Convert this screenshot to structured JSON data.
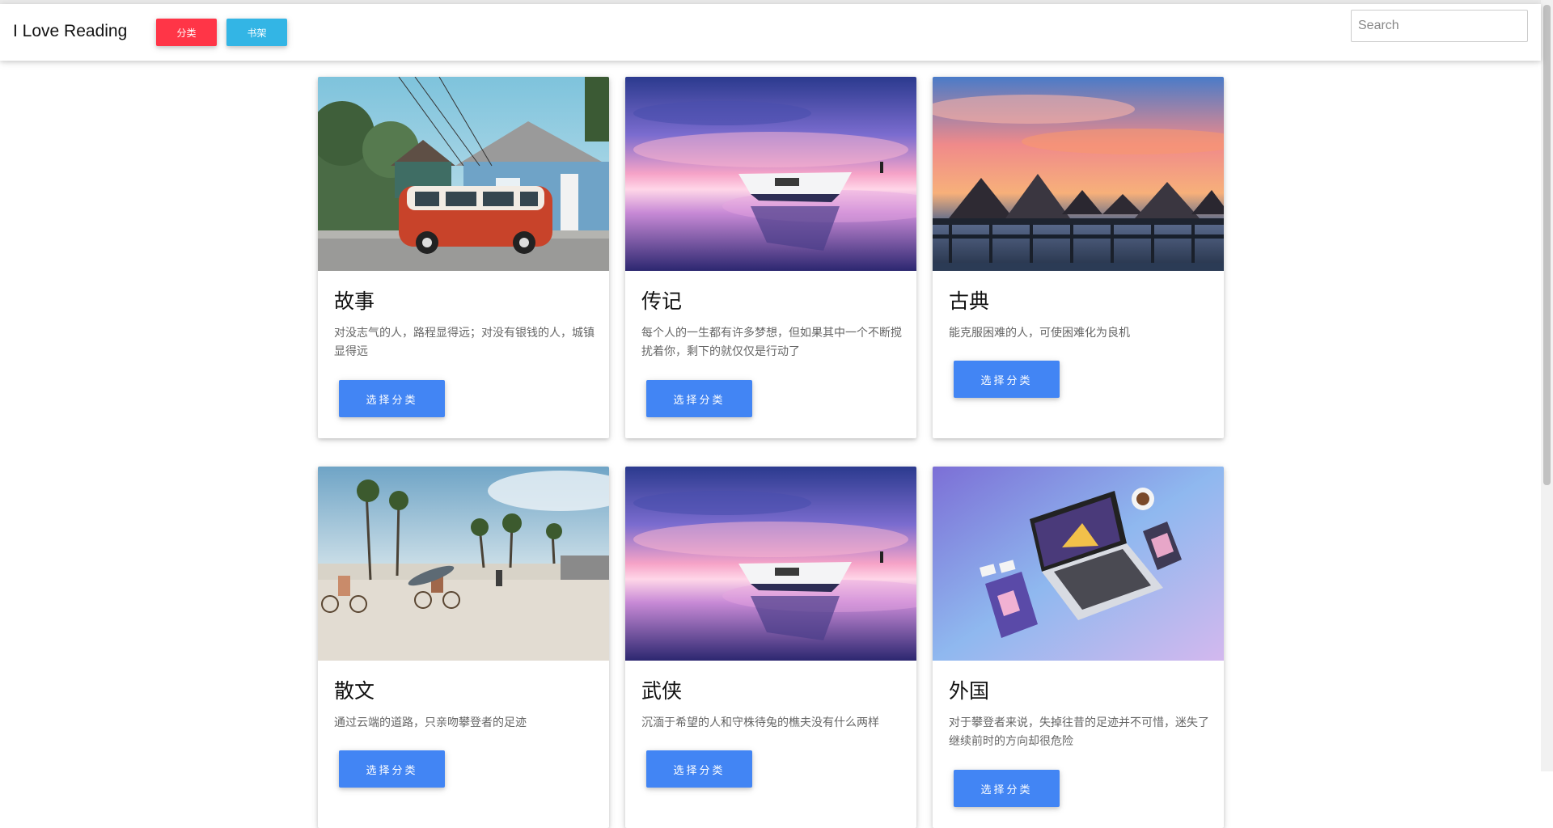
{
  "navbar": {
    "brand": "I Love Reading",
    "category_button": "分类",
    "shelf_button": "书架",
    "search_placeholder": "Search"
  },
  "colors": {
    "category_button": "#ff3547",
    "shelf_button": "#33b5e5",
    "select_button": "#4285f4"
  },
  "cards": [
    {
      "title": "故事",
      "description": "对没志气的人，路程显得远；对没有银钱的人，城镇显得远",
      "button": "选择分类",
      "image": "van-street-photo"
    },
    {
      "title": "传记",
      "description": "每个人的一生都有许多梦想，但如果其中一个不断搅扰着你，剩下的就仅仅是行动了",
      "button": "选择分类",
      "image": "boat-sunset-photo"
    },
    {
      "title": "古典",
      "description": "能克服困难的人，可使困难化为良机",
      "button": "选择分类",
      "image": "overwater-bungalows-photo"
    },
    {
      "title": "散文",
      "description": "通过云端的道路，只亲吻攀登者的足迹",
      "button": "选择分类",
      "image": "beach-cyclists-photo"
    },
    {
      "title": "武侠",
      "description": "沉湎于希望的人和守株待兔的樵夫没有什么两样",
      "button": "选择分类",
      "image": "boat-sunset-photo"
    },
    {
      "title": "外国",
      "description": "对于攀登者来说，失掉往昔的足迹并不可惜，迷失了继续前时的方向却很危险",
      "button": "选择分类",
      "image": "laptop-mockup-photo"
    }
  ]
}
